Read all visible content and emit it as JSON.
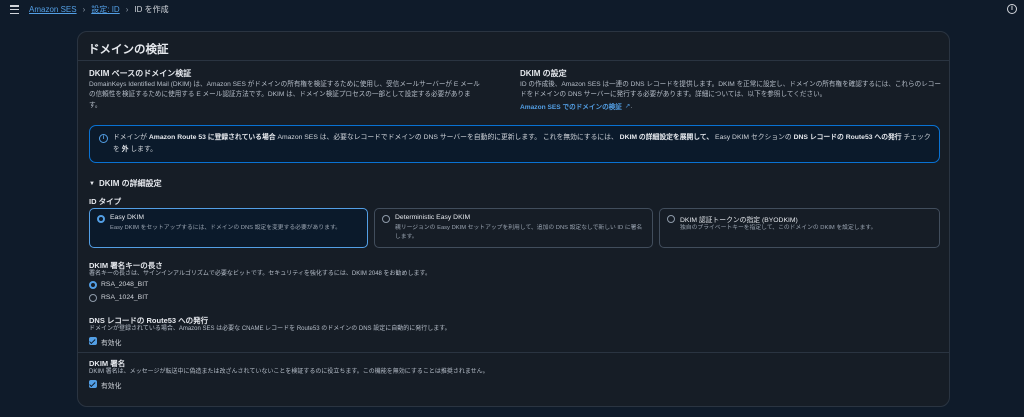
{
  "breadcrumb": {
    "items": [
      "Amazon SES",
      "設定: ID"
    ],
    "current": "ID を作成"
  },
  "section": {
    "title": "ドメインの検証",
    "dkim_based": {
      "heading": "DKIM ベースのドメイン検証",
      "description": "DomainKeys Identified Mail (DKIM) は、Amazon SES がドメインの所有権を検証するために使用し、受信メールサーバーが E メールの信頼性を検証するために使用する E メール認証方法です。DKIM は、ドメイン検証プロセスの一部として設定する必要があります。"
    },
    "dkim_setup": {
      "heading": "DKIM の設定",
      "description": "ID の作成後、Amazon SES は一連の DNS レコードを提供します。DKIM を正常に設定し、ドメインの所有権を確認するには、これらのレコードをドメインの DNS サーバーに発行する必要があります。詳細については、以下を参照してください。",
      "link": "Amazon SES でのドメインの検証"
    },
    "info_alert": {
      "part1": "ドメインが ",
      "bold1": "Amazon Route 53 に登録されている場合",
      "part2": " Amazon SES は、必要なレコードでドメインの DNS サーバーを自動的に更新します。 これを無効にするには、 ",
      "bold2": "DKIM の詳細設定を展開して、",
      "part3": " Easy DKIM セクションの ",
      "bold3": "DNS レコードの Route53 への発行",
      "part4": " チェックを ",
      "bold4": "外",
      "part5": " します。"
    },
    "advanced": {
      "label": "DKIM の詳細設定",
      "id_type_label": "ID タイプ",
      "tiles": [
        {
          "title": "Easy DKIM",
          "description": "Easy DKIM をセットアップするには、ドメインの DNS 設定を変更する必要があります。",
          "selected": true
        },
        {
          "title": "Deterministic Easy DKIM",
          "description": "親リージョンの Easy DKIM セットアップを利用して、追加の DNS 設定なしで新しい ID に署名します。",
          "selected": false
        },
        {
          "title": "DKIM 認証トークンの指定 (BYODKIM)",
          "description": "独自のプライベートキーを指定して、このドメインの DKIM を設定します。",
          "selected": false
        }
      ],
      "key_length": {
        "label": "DKIM 署名キーの長さ",
        "description": "署名キーの長さは、サインインアルゴリズムで必要なビットです。セキュリティを強化するには、DKIM 2048 をお勧めします。",
        "options": [
          {
            "label": "RSA_2048_BIT",
            "selected": true
          },
          {
            "label": "RSA_1024_BIT",
            "selected": false
          }
        ]
      },
      "route53": {
        "label": "DNS レコードの Route53 への発行",
        "description": "ドメインが登録されている場合、Amazon SES は必要な CNAME レコードを Route53 のドメインの DNS 設定に自動的に発行します。",
        "checkbox_label": "有効化"
      },
      "signing": {
        "label": "DKIM 署名",
        "description": "DKIM 署名は、メッセージが転送中に偽造または改ざんされていないことを検証するのに役立ちます。この機能を無効にすることは推奨されません。",
        "checkbox_label": "有効化"
      }
    }
  }
}
